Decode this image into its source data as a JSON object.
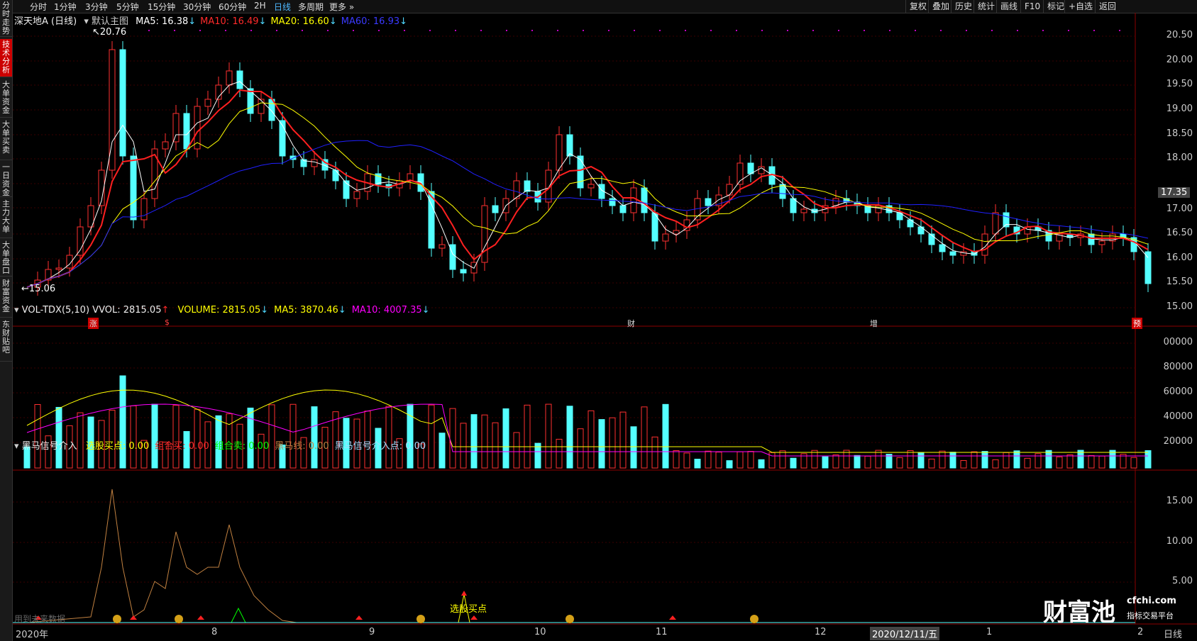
{
  "sidebar": {
    "tabs": [
      "分时走势",
      "技术分析",
      "大单资金",
      "大单买卖",
      "一日资金",
      "主力大单",
      "大单盘口",
      "财富资金",
      "东财贴吧"
    ],
    "active_index": 1
  },
  "timeframes": [
    "分时",
    "1分钟",
    "3分钟",
    "5分钟",
    "15分钟",
    "30分钟",
    "60分钟",
    "2H",
    "日线",
    "多周期",
    "更多"
  ],
  "selected_timeframe": "日线",
  "right_tools": [
    "复权",
    "叠加",
    "历史",
    "统计",
    "画线",
    "F10",
    "标记",
    "+自选",
    "返回"
  ],
  "main": {
    "stock": "深天地A (日线)",
    "template": "默认主图",
    "ma": [
      {
        "label": "MA5: 16.38",
        "arrow": "↓",
        "color": "#ffffff"
      },
      {
        "label": "MA10: 16.49",
        "arrow": "↓",
        "color": "#ff2a2a"
      },
      {
        "label": "MA20: 16.60",
        "arrow": "↓",
        "color": "#ffff00"
      },
      {
        "label": "MA60: 16.93",
        "arrow": "↓",
        "color": "#3a3aff"
      }
    ],
    "high_label": "20.76",
    "low_label": "15.06",
    "current_price": "17.35",
    "y_ticks": [
      "20.50",
      "20.00",
      "19.50",
      "19.00",
      "18.50",
      "18.00",
      "17.35",
      "17.00",
      "16.50",
      "16.00",
      "15.50",
      "15.00"
    ],
    "events": [
      {
        "label": "涨"
      },
      {
        "label": "$"
      },
      {
        "label": "财"
      },
      {
        "label": "增"
      },
      {
        "label": "预"
      }
    ]
  },
  "volume": {
    "title": "VOL-TDX(5,10)",
    "vvol": "VVOL: 2815.05",
    "items": [
      {
        "label": "VOLUME: 2815.05",
        "arrow": "↓",
        "color": "#ffff00"
      },
      {
        "label": "MA5: 3870.46",
        "arrow": "↓",
        "color": "#ffff00"
      },
      {
        "label": "MA10: 4007.35",
        "arrow": "↓",
        "color": "#ff00ff"
      }
    ],
    "y_ticks": [
      "00000",
      "80000",
      "60000",
      "40000",
      "20000"
    ]
  },
  "signal": {
    "title": "黑马信号介入",
    "items": [
      {
        "label": "选股买点: 0.00",
        "color": "#ffff00"
      },
      {
        "label": "组合买: 0.00",
        "color": "#ff2a2a"
      },
      {
        "label": "组合卖: 0.00",
        "color": "#00ff00"
      },
      {
        "label": "黑马线: 0.00",
        "color": "#c08040"
      },
      {
        "label": "黑马信号介入点: 0.00",
        "color": "#aaddff"
      }
    ],
    "y_ticks": [
      "15.00",
      "10.00",
      "5.00"
    ],
    "annotation": "选股买点",
    "future_text": "用到未来数据"
  },
  "x_labels": [
    "2020年",
    "8",
    "9",
    "10",
    "11",
    "12",
    "2020/12/11/五",
    "1",
    "2"
  ],
  "period_label": "日线",
  "watermark": {
    "brand": "财富池",
    "domain": "cfchi.com",
    "tagline": "指标交易平台"
  }
}
